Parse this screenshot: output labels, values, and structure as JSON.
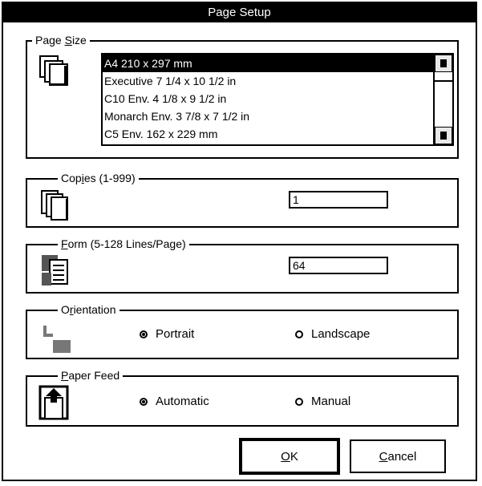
{
  "window": {
    "title": "Page Setup"
  },
  "page_size": {
    "legend_pre": "Page ",
    "legend_u": "S",
    "legend_post": "ize",
    "icon": "page-size-icon",
    "items": [
      "A4 210 x 297 mm",
      "Executive 7 1/4 x 10 1/2 in",
      "C10 Env. 4 1/8 x 9 1/2 in",
      "Monarch Env. 3 7/8 x 7 1/2 in",
      "C5 Env. 162 x 229 mm"
    ],
    "selected_index": 0
  },
  "copies": {
    "legend_pre": "Cop",
    "legend_u": "i",
    "legend_post": "es (1-999)",
    "value": "1",
    "icon": "copies-icon"
  },
  "form": {
    "legend_pre": "",
    "legend_u": "F",
    "legend_post": "orm (5-128 Lines/Page)",
    "value": "64",
    "icon": "form-icon"
  },
  "orientation": {
    "legend_pre": "O",
    "legend_u": "r",
    "legend_post": "ientation",
    "options": [
      "Portrait",
      "Landscape"
    ],
    "selected": "Portrait",
    "icon": "orientation-icon"
  },
  "paper_feed": {
    "legend_pre": "",
    "legend_u": "P",
    "legend_post": "aper Feed",
    "options": [
      "Automatic",
      "Manual"
    ],
    "selected": "Automatic",
    "icon": "paper-feed-icon"
  },
  "buttons": {
    "ok_u": "O",
    "ok_post": "K",
    "cancel_u": "C",
    "cancel_post": "ancel"
  }
}
